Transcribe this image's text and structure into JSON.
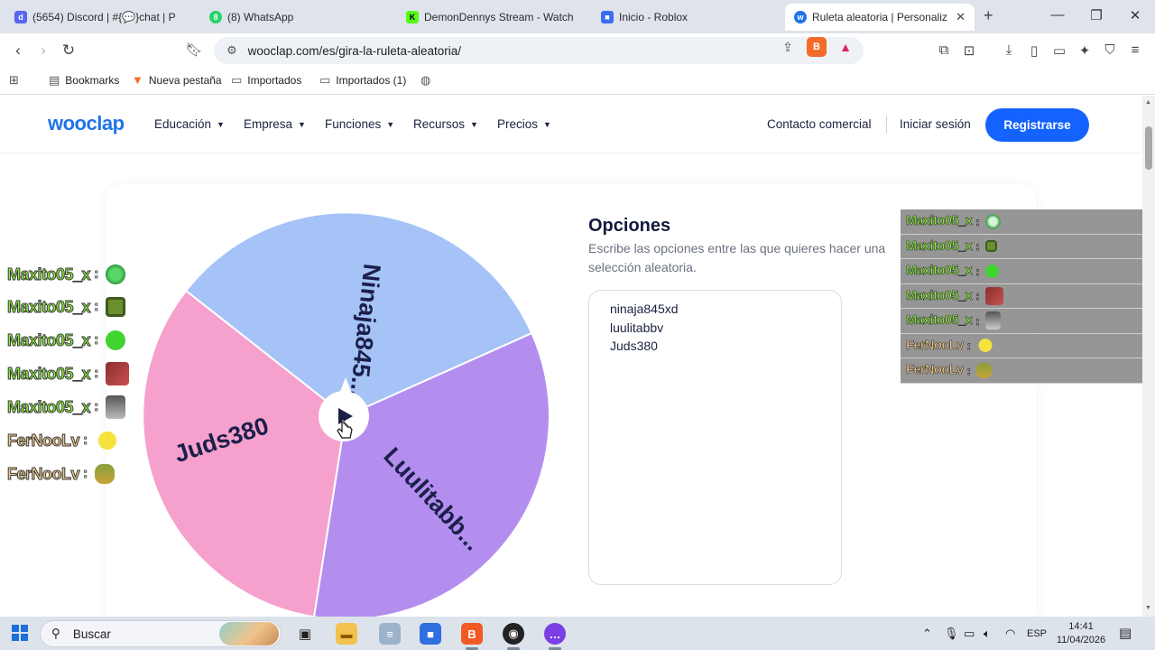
{
  "browser": {
    "tabs": [
      {
        "title": "(5654) Discord | #{💬}chat | P",
        "icon": "discord-icon",
        "color": "#5865f2"
      },
      {
        "title": "(8) WhatsApp",
        "icon": "whatsapp-icon",
        "color": "#25d366"
      },
      {
        "title": "DemonDennys Stream - Watch",
        "icon": "kick-icon",
        "color": "#53fc18"
      },
      {
        "title": "Inicio - Roblox",
        "icon": "roblox-icon",
        "color": "#3a6df0"
      },
      {
        "title": "Ruleta aleatoria | Personaliza",
        "icon": "wooclap-icon",
        "color": "#1f73e8",
        "active": true
      }
    ],
    "url": "wooclap.com/es/gira-la-ruleta-aleatoria/",
    "bookmarks": [
      {
        "label": "Bookmarks",
        "icon": "bookmark-icon"
      },
      {
        "label": "Nueva pestaña",
        "icon": "brave-icon"
      },
      {
        "label": "Importados",
        "icon": "folder-icon"
      },
      {
        "label": "Importados (1)",
        "icon": "folder-icon"
      }
    ],
    "shield_count": "1"
  },
  "site": {
    "logo": "wooclap",
    "nav": [
      "Educación",
      "Empresa",
      "Funciones",
      "Recursos",
      "Precios"
    ],
    "contact": "Contacto comercial",
    "login": "Iniciar sesión",
    "register": "Registrarse"
  },
  "wheel": {
    "segments": [
      {
        "label": "Ninaja845...",
        "color": "#a5c3f7"
      },
      {
        "label": "Luulitabb...",
        "color": "#b38eef"
      },
      {
        "label": "Juds380",
        "color": "#f6a0cd"
      }
    ]
  },
  "options": {
    "title": "Opciones",
    "description": "Escribe las opciones entre las que quieres hacer una selección aleatoria.",
    "entries": [
      "ninaja845xd",
      "luulitabbv",
      "Juds380"
    ]
  },
  "chat_left": [
    {
      "user": "Maxito05_x",
      "sep": ":",
      "color": "#8cf03c",
      "emote": "green-creature-emote"
    },
    {
      "user": "Maxito05_x",
      "sep": ":",
      "color": "#8cf03c",
      "emote": "frog-emote"
    },
    {
      "user": "Maxito05_x",
      "sep": ":",
      "color": "#8cf03c",
      "emote": "green-blob-emote"
    },
    {
      "user": "Maxito05_x",
      "sep": ":",
      "color": "#8cf03c",
      "emote": "red-face-emote"
    },
    {
      "user": "Maxito05_x",
      "sep": ":",
      "color": "#8cf03c",
      "emote": "man-face-emote"
    },
    {
      "user": "FerNooLv",
      "sep": ":",
      "color": "#f3c98a",
      "emote": "yellow-chick-emote"
    },
    {
      "user": "FerNooLv",
      "sep": ":",
      "color": "#f3c98a",
      "emote": "pepe-emote"
    }
  ],
  "chat_right": [
    {
      "user": "Maxito05_x",
      "sep": ":",
      "color": "#8cf03c",
      "emote": "green-creature-emote"
    },
    {
      "user": "Maxito05_x",
      "sep": ":",
      "color": "#8cf03c",
      "emote": "frog-emote"
    },
    {
      "user": "Maxito05_x",
      "sep": ":",
      "color": "#8cf03c",
      "emote": "green-blob-emote"
    },
    {
      "user": "Maxito05_x",
      "sep": ":",
      "color": "#8cf03c",
      "emote": "red-face-emote"
    },
    {
      "user": "Maxito05_x",
      "sep": ":",
      "color": "#8cf03c",
      "emote": "man-face-emote"
    },
    {
      "user": "FerNooLv",
      "sep": ":",
      "color": "#f3c98a",
      "emote": "yellow-chick-emote"
    },
    {
      "user": "FerNooLv",
      "sep": ":",
      "color": "#f3c98a",
      "emote": "pepe-emote"
    }
  ],
  "taskbar": {
    "search_placeholder": "Buscar",
    "language": "ESP",
    "time": "14:41",
    "date": "11/04/2026"
  }
}
